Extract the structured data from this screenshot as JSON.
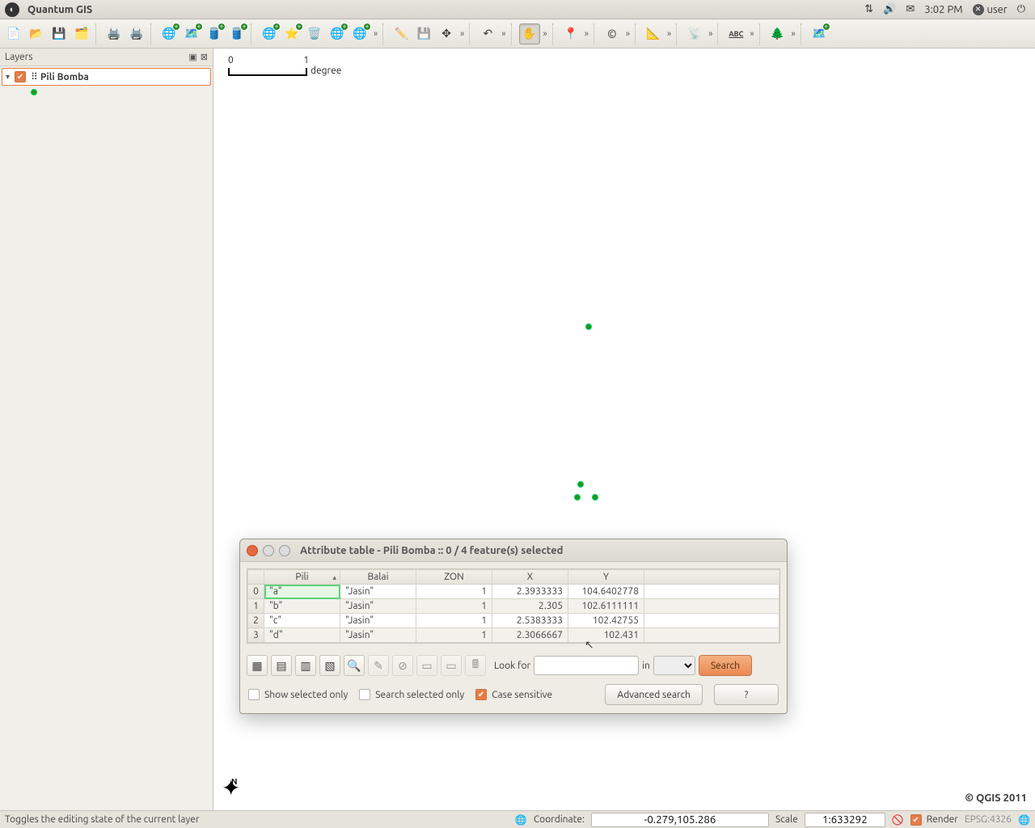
{
  "sys": {
    "app_title": "Quantum GIS",
    "time": "3:02 PM",
    "user": "user"
  },
  "layers": {
    "panel_title": "Layers",
    "item": {
      "name": "Pili Bomba"
    }
  },
  "canvas": {
    "scale_min": "0",
    "scale_max": "1",
    "scale_unit": "degree",
    "copyright": "© QGIS 2011",
    "north_label": "N"
  },
  "dialog": {
    "title": "Attribute table - Pili Bomba :: 0 / 4 feature(s) selected",
    "columns": [
      "Pili",
      "Balai",
      "ZON",
      "X",
      "Y"
    ],
    "rows": [
      {
        "n": "0",
        "pili": "\"a\"",
        "balai": "\"Jasin\"",
        "zon": "1",
        "x": "2.3933333",
        "y": "104.6402778"
      },
      {
        "n": "1",
        "pili": "\"b\"",
        "balai": "\"Jasin\"",
        "zon": "1",
        "x": "2.305",
        "y": "102.6111111"
      },
      {
        "n": "2",
        "pili": "\"c\"",
        "balai": "\"Jasin\"",
        "zon": "1",
        "x": "2.5383333",
        "y": "102.42755"
      },
      {
        "n": "3",
        "pili": "\"d\"",
        "balai": "\"Jasin\"",
        "zon": "1",
        "x": "2.3066667",
        "y": "102.431"
      }
    ],
    "lookfor_label": "Look for",
    "in_label": "in",
    "search_btn": "Search",
    "opt_show_selected": "Show selected only",
    "opt_search_selected": "Search selected only",
    "opt_case": "Case sensitive",
    "adv_btn": "Advanced search",
    "help_btn": "?"
  },
  "status": {
    "hint": "Toggles the editing state of the current layer",
    "coord_label": "Coordinate:",
    "coord_value": "-0.279,105.286",
    "scale_label": "Scale",
    "scale_value": "1:633292",
    "render_label": "Render",
    "crs": "EPSG:4326"
  }
}
